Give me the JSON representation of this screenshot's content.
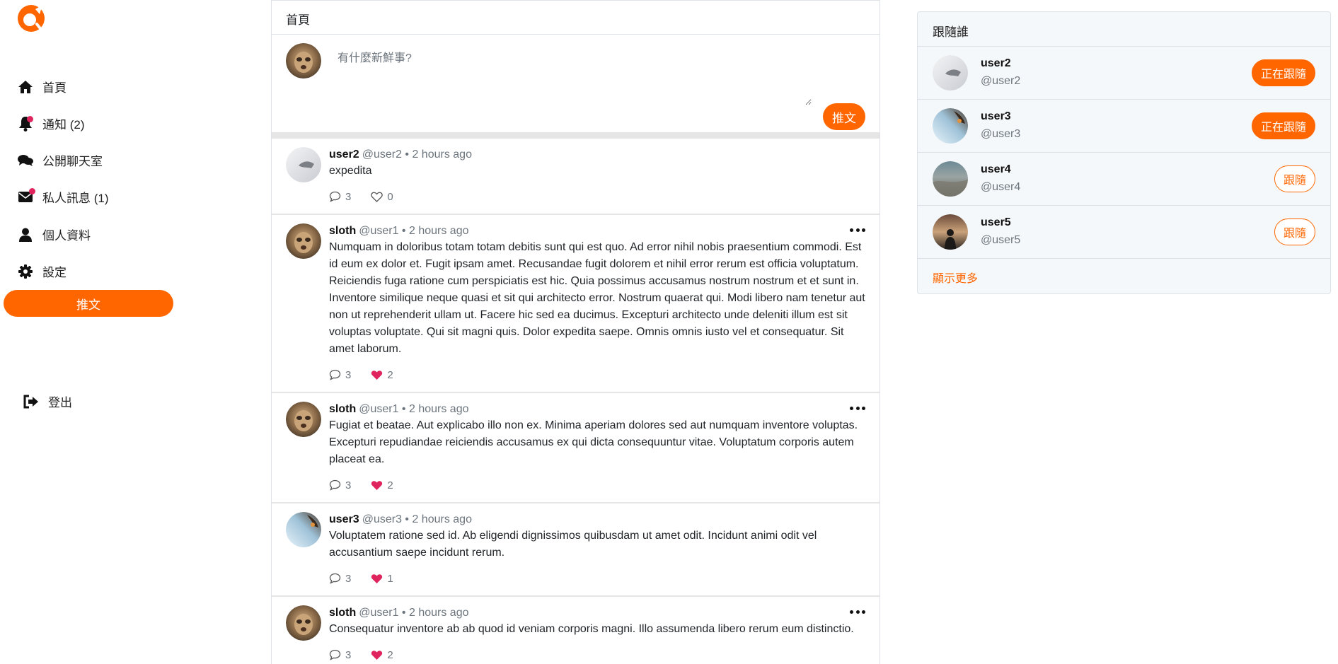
{
  "colors": {
    "brand": "#ff6600",
    "like": "#e0245e",
    "muted": "#6c757d"
  },
  "sidebar": {
    "items": [
      {
        "label": "首頁",
        "icon": "home-icon"
      },
      {
        "label": "通知 (2)",
        "icon": "bell-icon"
      },
      {
        "label": "公開聊天室",
        "icon": "chat-icon"
      },
      {
        "label": "私人訊息 (1)",
        "icon": "envelope-icon"
      },
      {
        "label": "個人資料",
        "icon": "user-icon"
      },
      {
        "label": "設定",
        "icon": "gear-icon"
      }
    ],
    "tweet_label": "推文",
    "logout_label": "登出"
  },
  "main": {
    "title": "首頁",
    "compose": {
      "placeholder": "有什麼新鮮事?",
      "tweet_label": "推文"
    },
    "posts": [
      {
        "name": "user2",
        "meta": "@user2 • 2 hours ago",
        "body": "expedita",
        "replies": "3",
        "likes": "0",
        "liked": false
      },
      {
        "name": "sloth",
        "meta": "@user1 • 2 hours ago",
        "body": "Numquam in doloribus totam totam debitis sunt qui est quo. Ad error nihil nobis praesentium commodi. Est id eum ex dolor et. Fugit ipsam amet. Recusandae fugit dolorem et nihil error rerum est officia voluptatum. Reiciendis fuga ratione cum perspiciatis est hic. Quia possimus accusamus nostrum nostrum et et sunt in. Inventore similique neque quasi et sit qui architecto error. Nostrum quaerat qui. Modi libero nam tenetur aut non ut reprehenderit ullam ut. Facere hic sed ea ducimus. Excepturi architecto unde deleniti illum est sit voluptas voluptate. Qui sit magni quis. Dolor expedita saepe. Omnis omnis iusto vel et consequatur. Sit amet laborum.",
        "replies": "3",
        "likes": "2",
        "liked": true
      },
      {
        "name": "sloth",
        "meta": "@user1 • 2 hours ago",
        "body": "Fugiat et beatae. Aut explicabo illo non ex. Minima aperiam dolores sed aut numquam inventore voluptas. Excepturi repudiandae reiciendis accusamus ex qui dicta consequuntur vitae. Voluptatum corporis autem placeat ea.",
        "replies": "3",
        "likes": "2",
        "liked": true
      },
      {
        "name": "user3",
        "meta": "@user3 • 2 hours ago",
        "body": "Voluptatem ratione sed id. Ab eligendi dignissimos quibusdam ut amet odit. Incidunt animi odit vel accusantium saepe incidunt rerum.",
        "replies": "3",
        "likes": "1",
        "liked": true
      },
      {
        "name": "sloth",
        "meta": "@user1 • 2 hours ago",
        "body": "Consequatur inventore ab ab quod id veniam corporis magni. Illo assumenda libero rerum eum distinctio.",
        "replies": "3",
        "likes": "2",
        "liked": true
      }
    ]
  },
  "follow": {
    "title": "跟隨誰",
    "users": [
      {
        "name": "user2",
        "handle": "@user2",
        "button": "正在跟隨",
        "following": true
      },
      {
        "name": "user3",
        "handle": "@user3",
        "button": "正在跟隨",
        "following": true
      },
      {
        "name": "user4",
        "handle": "@user4",
        "button": "跟隨",
        "following": false
      },
      {
        "name": "user5",
        "handle": "@user5",
        "button": "跟隨",
        "following": false
      }
    ],
    "show_more": "顯示更多"
  }
}
